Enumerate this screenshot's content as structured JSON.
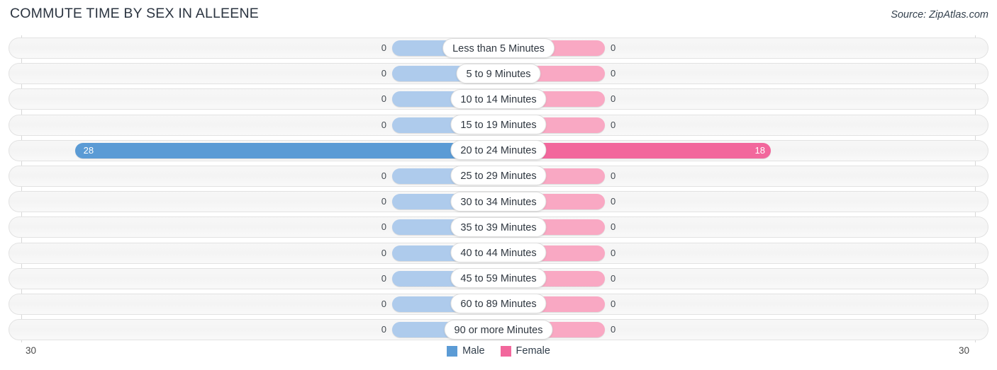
{
  "header": {
    "title": "COMMUTE TIME BY SEX IN ALLEENE",
    "source": "Source: ZipAtlas.com"
  },
  "legend": {
    "male_label": "Male",
    "female_label": "Female",
    "male_color": "#5b9bd5",
    "female_color": "#f2679c",
    "male_zero_color": "#aecbec",
    "female_zero_color": "#f9a8c3"
  },
  "axis": {
    "left_label": "30",
    "right_label": "30",
    "max": 30
  },
  "chart_data": {
    "type": "bar",
    "title": "COMMUTE TIME BY SEX IN ALLEENE",
    "subtitle": "Source: ZipAtlas.com",
    "orientation": "horizontal-diverging",
    "xlabel": "",
    "ylabel": "",
    "xlim": [
      30,
      30
    ],
    "grid": true,
    "legend_position": "bottom-center",
    "categories": [
      "Less than 5 Minutes",
      "5 to 9 Minutes",
      "10 to 14 Minutes",
      "15 to 19 Minutes",
      "20 to 24 Minutes",
      "25 to 29 Minutes",
      "30 to 34 Minutes",
      "35 to 39 Minutes",
      "40 to 44 Minutes",
      "45 to 59 Minutes",
      "60 to 89 Minutes",
      "90 or more Minutes"
    ],
    "series": [
      {
        "name": "Male",
        "color": "#5b9bd5",
        "values": [
          0,
          0,
          0,
          0,
          28,
          0,
          0,
          0,
          0,
          0,
          0,
          0
        ]
      },
      {
        "name": "Female",
        "color": "#f2679c",
        "values": [
          0,
          0,
          0,
          0,
          18,
          0,
          0,
          0,
          0,
          0,
          0,
          0
        ]
      }
    ]
  },
  "rows": [
    {
      "label": "Less than 5 Minutes",
      "male": "0",
      "female": "0"
    },
    {
      "label": "5 to 9 Minutes",
      "male": "0",
      "female": "0"
    },
    {
      "label": "10 to 14 Minutes",
      "male": "0",
      "female": "0"
    },
    {
      "label": "15 to 19 Minutes",
      "male": "0",
      "female": "0"
    },
    {
      "label": "20 to 24 Minutes",
      "male": "28",
      "female": "18"
    },
    {
      "label": "25 to 29 Minutes",
      "male": "0",
      "female": "0"
    },
    {
      "label": "30 to 34 Minutes",
      "male": "0",
      "female": "0"
    },
    {
      "label": "35 to 39 Minutes",
      "male": "0",
      "female": "0"
    },
    {
      "label": "40 to 44 Minutes",
      "male": "0",
      "female": "0"
    },
    {
      "label": "45 to 59 Minutes",
      "male": "0",
      "female": "0"
    },
    {
      "label": "60 to 89 Minutes",
      "male": "0",
      "female": "0"
    },
    {
      "label": "90 or more Minutes",
      "male": "0",
      "female": "0"
    }
  ]
}
